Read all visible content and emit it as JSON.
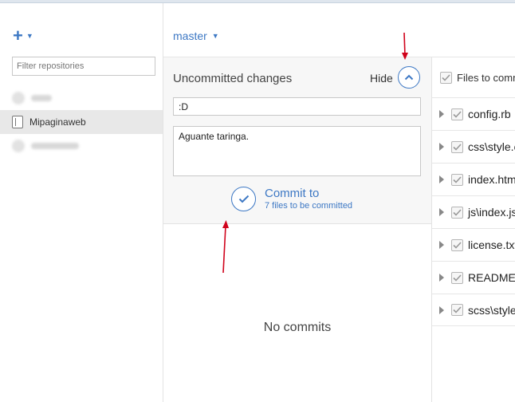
{
  "sidebar": {
    "add_icon": "plus-icon",
    "filter_placeholder": "Filter repositories",
    "repos": [
      {
        "label": "",
        "blurred": true
      },
      {
        "label": "Mipaginaweb",
        "selected": true
      },
      {
        "label": "",
        "blurred": true
      }
    ]
  },
  "branch": {
    "label": "master"
  },
  "uncommitted": {
    "title": "Uncommitted changes",
    "hide_label": "Hide",
    "summary_value": ":D",
    "description_value": "Aguante taringa.",
    "commit_label": "Commit to",
    "commit_sub": "7 files to be committed"
  },
  "history": {
    "empty_text": "No commits"
  },
  "files": {
    "header_label": "Files to commit",
    "items": [
      {
        "name": "config.rb"
      },
      {
        "name": "css\\style.css"
      },
      {
        "name": "index.html"
      },
      {
        "name": "js\\index.js"
      },
      {
        "name": "license.txt"
      },
      {
        "name": "README.md"
      },
      {
        "name": "scss\\style.scss"
      }
    ]
  },
  "colors": {
    "accent": "#3d78c4",
    "annotation": "#d0021b"
  }
}
